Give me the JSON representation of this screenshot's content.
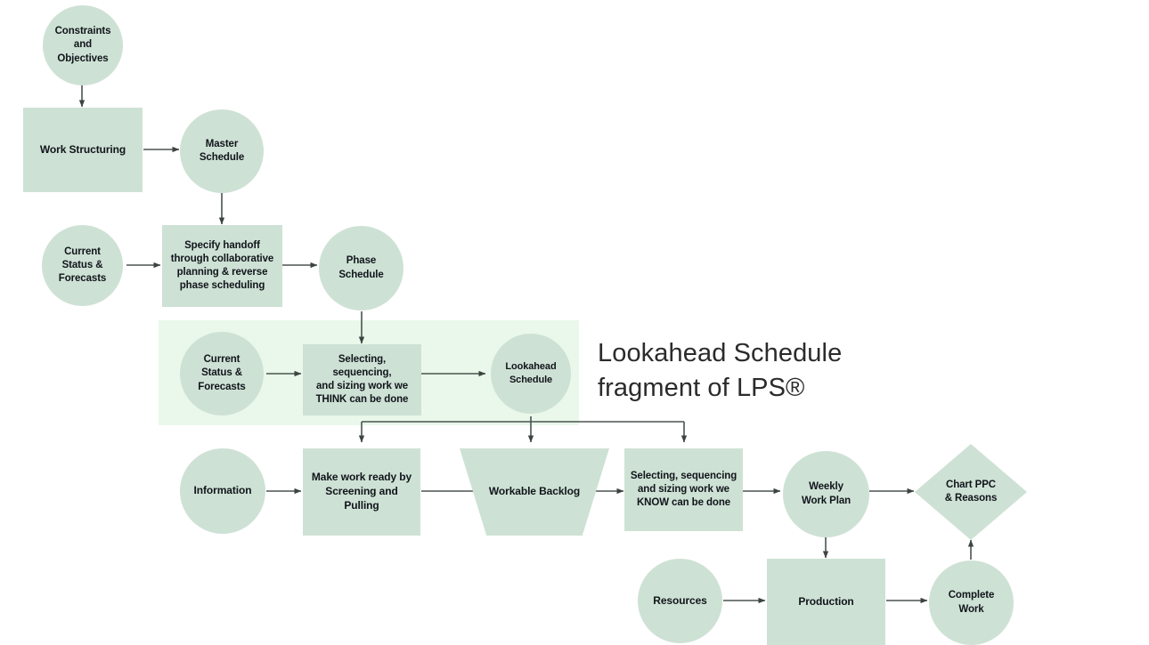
{
  "diagram": {
    "title_overlay": "Lookahead Schedule\nfragment of LPS®",
    "colors": {
      "shape_fill": "#cee1d5",
      "band_fill": "#e9f8ea",
      "connector": "#4a5450",
      "text": "#10151a",
      "title_text": "#2b2b2b",
      "background": "#ffffff"
    },
    "nodes": [
      {
        "id": "constraints-and-objectives",
        "label": "Constraints\nand\nObjectives",
        "shape": "circle"
      },
      {
        "id": "work-structuring",
        "label": "Work Structuring",
        "shape": "rect"
      },
      {
        "id": "master-schedule",
        "label": "Master\nSchedule",
        "shape": "circle"
      },
      {
        "id": "current-status-forecasts-upper",
        "label": "Current\nStatus &\nForecasts",
        "shape": "circle"
      },
      {
        "id": "specify-handoff",
        "label": "Specify handoff\nthrough collaborative\nplanning & reverse\nphase scheduling",
        "shape": "rect"
      },
      {
        "id": "phase-schedule",
        "label": "Phase\nSchedule",
        "shape": "circle"
      },
      {
        "id": "current-status-forecasts-lower",
        "label": "Current\nStatus &\nForecasts",
        "shape": "circle"
      },
      {
        "id": "selecting-think",
        "label": "Selecting, sequencing,\nand sizing work we\nTHINK can be done",
        "shape": "rect"
      },
      {
        "id": "lookahead-schedule",
        "label": "Lookahead\nSchedule",
        "shape": "circle"
      },
      {
        "id": "information",
        "label": "Information",
        "shape": "circle"
      },
      {
        "id": "make-work-ready",
        "label": "Make work ready by\nScreening and Pulling",
        "shape": "rect"
      },
      {
        "id": "workable-backlog",
        "label": "Workable Backlog",
        "shape": "trapezoid"
      },
      {
        "id": "selecting-know",
        "label": "Selecting, sequencing\nand sizing work we\nKNOW can be done",
        "shape": "rect"
      },
      {
        "id": "weekly-work-plan",
        "label": "Weekly\nWork Plan",
        "shape": "circle"
      },
      {
        "id": "chart-ppc-reasons",
        "label": "Chart PPC\n& Reasons",
        "shape": "diamond"
      },
      {
        "id": "resources",
        "label": "Resources",
        "shape": "circle"
      },
      {
        "id": "production",
        "label": "Production",
        "shape": "rect"
      },
      {
        "id": "complete-work",
        "label": "Complete\nWork",
        "shape": "circle"
      }
    ],
    "connections": [
      {
        "from": "constraints-and-objectives",
        "to": "work-structuring"
      },
      {
        "from": "work-structuring",
        "to": "master-schedule"
      },
      {
        "from": "master-schedule",
        "to": "specify-handoff"
      },
      {
        "from": "current-status-forecasts-upper",
        "to": "specify-handoff"
      },
      {
        "from": "specify-handoff",
        "to": "phase-schedule"
      },
      {
        "from": "phase-schedule",
        "to": "selecting-think"
      },
      {
        "from": "current-status-forecasts-lower",
        "to": "selecting-think"
      },
      {
        "from": "selecting-think",
        "to": "lookahead-schedule"
      },
      {
        "from": "lookahead-schedule",
        "to": "make-work-ready"
      },
      {
        "from": "lookahead-schedule",
        "to": "workable-backlog"
      },
      {
        "from": "lookahead-schedule",
        "to": "selecting-know"
      },
      {
        "from": "information",
        "to": "make-work-ready"
      },
      {
        "from": "make-work-ready",
        "to": "workable-backlog"
      },
      {
        "from": "workable-backlog",
        "to": "selecting-know"
      },
      {
        "from": "selecting-know",
        "to": "weekly-work-plan"
      },
      {
        "from": "weekly-work-plan",
        "to": "chart-ppc-reasons"
      },
      {
        "from": "weekly-work-plan",
        "to": "production"
      },
      {
        "from": "resources",
        "to": "production"
      },
      {
        "from": "production",
        "to": "complete-work"
      },
      {
        "from": "complete-work",
        "to": "chart-ppc-reasons"
      }
    ]
  }
}
